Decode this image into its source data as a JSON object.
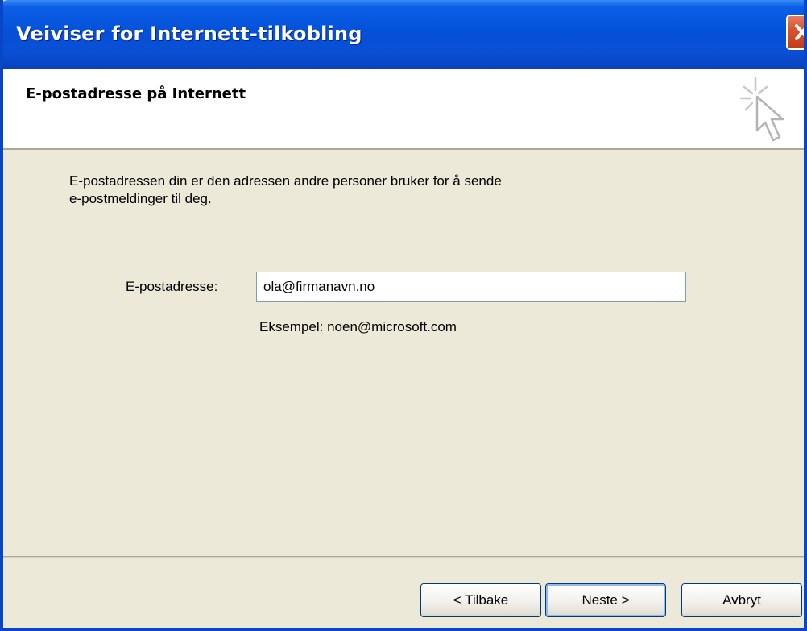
{
  "window": {
    "title": "Veiviser for Internett-tilkobling"
  },
  "header": {
    "title": "E-postadresse på Internett",
    "icon": "wizard-cursor-icon"
  },
  "body": {
    "description_line1": "E-postadressen din er den adressen andre personer bruker for å sende",
    "description_line2": "e-postmeldinger til deg.",
    "email_label": "E-postadresse:",
    "email_value": "ola@firmanavn.no",
    "example_text": "Eksempel: noen@microsoft.com"
  },
  "buttons": {
    "back_label": "< Tilbake",
    "next_label": "Neste >",
    "cancel_label": "Avbryt"
  },
  "colors": {
    "titlebar": "#0451d8",
    "close_button": "#d8542f",
    "dialog_background": "#ece9d8"
  }
}
